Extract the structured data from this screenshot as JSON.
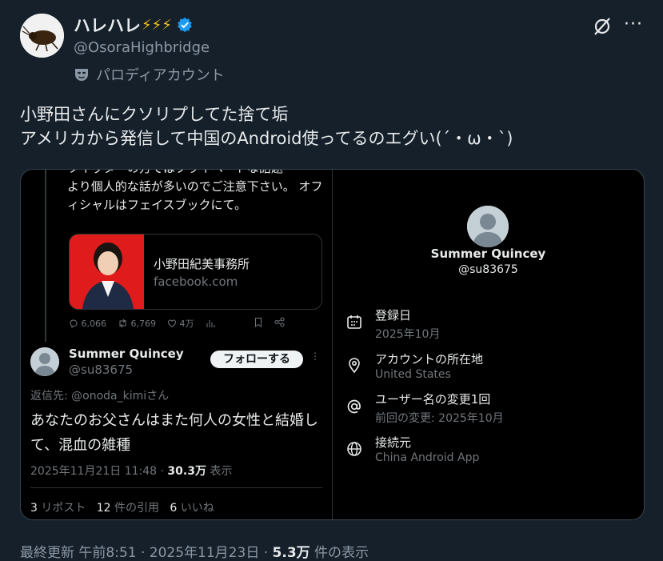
{
  "author": {
    "name": "ハレハレ",
    "bolts": "⚡⚡⚡",
    "handle": "@OsoraHighbridge",
    "parody_label": "パロディアカウント"
  },
  "tweet": {
    "line1": "小野田さんにクソリプしてた捨て垢",
    "line2": "アメリカから発信して中国のAndroid使ってるのエグい(´・ω・`)"
  },
  "screenshot": {
    "quoted": {
      "partial_line0": "ツイッターの方ではプライベートな話題",
      "text": "より個人的な話が多いのでご注意下さい。 オフィシャルはフェイスブックにて。",
      "link_title": "小野田紀美事務所",
      "link_domain": "facebook.com",
      "replies": "6,066",
      "reposts": "6,769",
      "likes": "4万"
    },
    "reply": {
      "name": "Summer Quincey",
      "handle": "@su83675",
      "follow_label": "フォローする",
      "reply_to": "返信先: @onoda_kimiさん",
      "body": "あなたのお父さんはまた何人の女性と結婚して、混血の雑種",
      "time": "2025年11月21日 11:48 · ",
      "views": "30.3万",
      "views_label": " 表示",
      "reposts_count": "3",
      "reposts_label": " リポスト",
      "quotes_count": "12",
      "quotes_label": " 件の引用",
      "likes_count": "6",
      "likes_label": " いいね"
    },
    "profile": {
      "name": "Summer Quincey",
      "handle": "@su83675",
      "rows": [
        {
          "label": "登録日",
          "value": "2025年10月",
          "icon": "calendar-icon"
        },
        {
          "label": "アカウントの所在地",
          "value": "United States",
          "icon": "location-pin-icon"
        },
        {
          "label": "ユーザー名の変更1回",
          "value": "前回の変更: 2025年10月",
          "icon": "at-sign-icon"
        },
        {
          "label": "接続元",
          "value": "China Android App",
          "icon": "globe-icon"
        }
      ]
    }
  },
  "footer": {
    "updated": "最終更新 午前8:51 · 2025年11月23日 · ",
    "views": "5.3万",
    "views_label": " 件の表示"
  },
  "colors": {
    "background": "#15202b",
    "verified": "#1d9bf0",
    "bolt": "#f5c518",
    "link_image": "#e01b1b"
  }
}
